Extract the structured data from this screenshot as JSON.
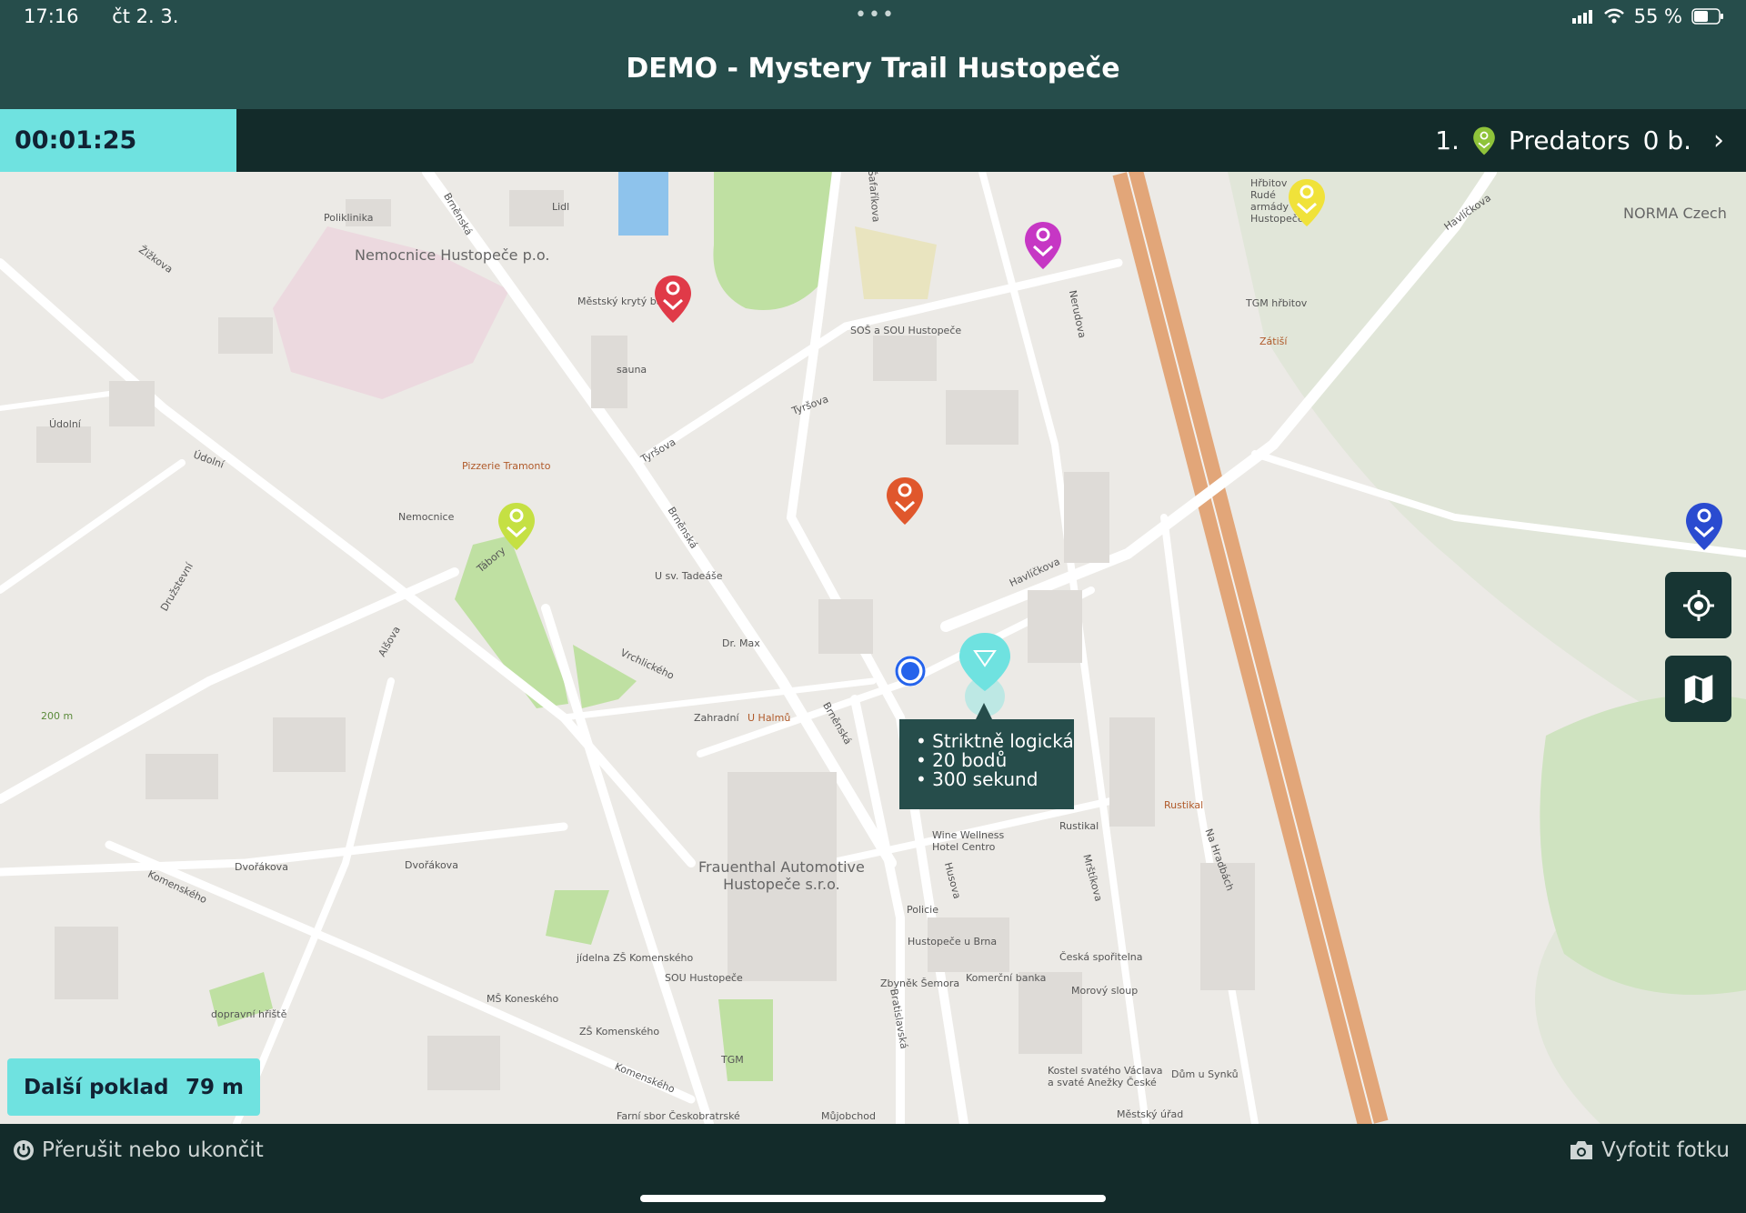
{
  "status": {
    "time": "17:16",
    "date": "čt 2. 3.",
    "dots": "•••",
    "battery": "55 %"
  },
  "header": {
    "title": "DEMO - Mystery Trail Hustopeče"
  },
  "scorebar": {
    "timer": "00:01:25",
    "rank": "1.",
    "team": "Predators",
    "points": "0 b.",
    "chevron": "›"
  },
  "map_labels": {
    "nemocnice": "Nemocnice\nHustopeče p.o.",
    "poliklinika": "Poliklinika",
    "lidl": "Lidl",
    "krytybazen": "Městský krytý bazén",
    "sauna": "sauna",
    "sos": "SOŠ a SOU Hustopeče",
    "hrbitov": "TGM hřbitov",
    "hrbitov_ra": "Hřbitov Rudé armády Hustopeče",
    "norma": "NORMA Czech",
    "zatisi": "Zátiší",
    "udolni": "Údolní",
    "udolni2": "Údolní",
    "tramonto": "Pizzerie Tramonto",
    "nemocnice_st": "Nemocnice",
    "tadease": "U sv. Tadeáše",
    "drmax": "Dr. Max",
    "uhalmu": "U Halmů",
    "zahradni": "Zahradní",
    "vrchlickeho": "Vrchlického",
    "frauenthal": "Frauenthal Automotive\nHustopeče s.r.o.",
    "wine": "Wine Wellness\nHotel Centro",
    "policie": "Policie",
    "hustopece_brna": "Hustopeče u Brna",
    "sporitelna": "Česká spořitelna",
    "komercni": "Komerční banka",
    "morovy": "Morový sloup",
    "zbynek": "Zbyněk Šemora",
    "rustikal": "Rustikal",
    "rustikal2": "Rustikal",
    "kostel": "Kostel svatého Václava\na svaté Anežky České",
    "dum_synku": "Dům u Synků",
    "mestsky_urad": "Městský úřad",
    "jidelna": "jídelna ZŠ Komenského",
    "sou": "SOU Hustopeče",
    "ms": "MŠ Koneského",
    "zs": "ZŠ Komenského",
    "tgm": "TGM",
    "farni": "Farní sbor Českobratrské",
    "mujobchod": "Můjobchod",
    "hriste": "dopravní hřiště",
    "brnenska": "Brněnská",
    "brnenska2": "Brněnská",
    "brnenska3": "Brněnská",
    "tyrsova": "Tyršova",
    "tyrsova2": "Tyršova",
    "havlickova": "Havlíčkova",
    "havlickova2": "Havlíčkova",
    "nerudova": "Nerudova",
    "safarikova": "Šafaříkova",
    "komenskeho": "Komenského",
    "komenskeho2": "Komenského",
    "dvorakova": "Dvořákova",
    "dvorakova2": "Dvořákova",
    "alsova": "Alšova",
    "taborysk": "Tábory",
    "zizkova": "Žižkova",
    "druzstevni": "Družstevní",
    "bratislavska": "Bratislavská",
    "husova": "Husova",
    "mrstikova": "Mrštíkova",
    "na_hradbach": "Na Hradbách",
    "m200": "200 m"
  },
  "tooltip": {
    "line1": "• Striktně logická",
    "line2": "• 20 bodů",
    "line3": "• 300 sekund"
  },
  "next_treasure": {
    "label": "Další poklad",
    "distance": "79 m"
  },
  "footer": {
    "stop": "Přerušit nebo ukončit",
    "photo": "Vyfotit fotku"
  },
  "pins": [
    {
      "name": "red-marker-pin",
      "color": "#e03a48"
    },
    {
      "name": "magenta-marker-pin",
      "color": "#c637c4"
    },
    {
      "name": "yellow-marker-pin",
      "color": "#f0e23a"
    },
    {
      "name": "orange-marker-pin",
      "color": "#e0572c"
    },
    {
      "name": "lime-marker-pin",
      "color": "#c5e043"
    },
    {
      "name": "blue-marker-pin",
      "color": "#2a4bd0"
    }
  ],
  "colors": {
    "header": "#264d4b",
    "dark": "#132b2a",
    "accent": "#6fe2e0",
    "highway": "#e2a679"
  }
}
